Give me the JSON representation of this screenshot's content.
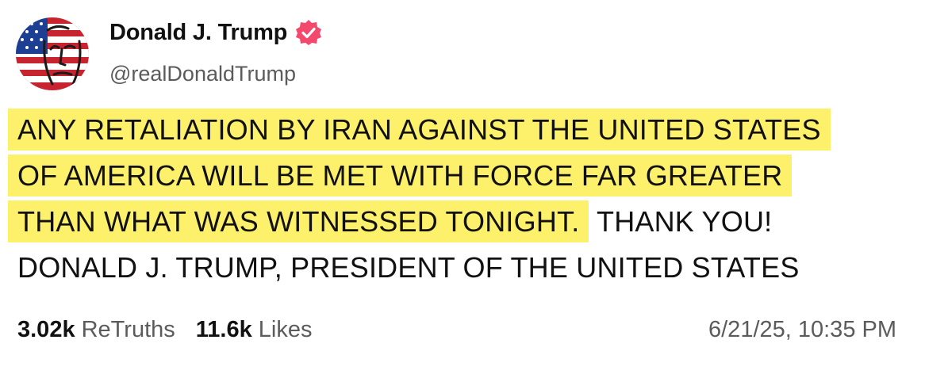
{
  "author": {
    "name": "Donald J. Trump",
    "handle": "@realDonaldTrump",
    "verified_badge_icon": "verified-badge-icon",
    "badge_color": "#f2496c"
  },
  "post": {
    "highlighted_lines": [
      "ANY RETALIATION BY IRAN AGAINST THE UNITED STATES",
      "OF AMERICA WILL BE MET WITH FORCE FAR GREATER",
      "THAN WHAT WAS WITNESSED TONIGHT."
    ],
    "trailing_text": "THANK YOU!",
    "last_line": "DONALD J. TRUMP, PRESIDENT OF THE UNITED STATES",
    "highlight_color": "#fdf06a"
  },
  "stats": {
    "retruths_count": "3.02k",
    "retruths_label": "ReTruths",
    "likes_count": "11.6k",
    "likes_label": "Likes"
  },
  "timestamp": "6/21/25, 10:35 PM"
}
